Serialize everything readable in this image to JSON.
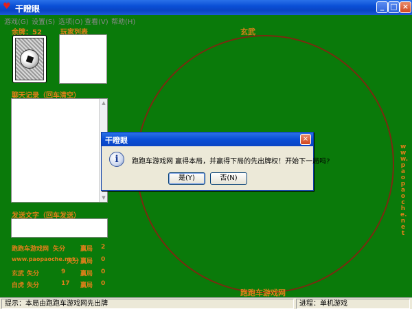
{
  "window": {
    "title": "干瞪眼"
  },
  "titlebar_buttons": {
    "minimize": "_",
    "maximize": "□",
    "close": "×"
  },
  "menu": [
    {
      "label": "游戏(G)"
    },
    {
      "label": "设置(S)"
    },
    {
      "label": "选项(O)"
    },
    {
      "label": "查看(V)"
    },
    {
      "label": "帮助(H)"
    }
  ],
  "left_panel": {
    "deck_label": "余牌：52",
    "player_list_label": "玩家列表",
    "chat_label": "聊天记录（回车清空）",
    "send_label": "发送文字（回车发送）",
    "scores": [
      {
        "name": "跑跑车游戏网",
        "score_label": "失分",
        "score": "",
        "win_label": "赢局",
        "wins": "2"
      },
      {
        "name": "www.paopaoche.net",
        "score_label": "失分",
        "score": "",
        "win_label": "赢局",
        "wins": "0"
      },
      {
        "name": "玄武",
        "score_label": "失分",
        "score": "9",
        "win_label": "赢局",
        "wins": "0"
      },
      {
        "name": "白虎",
        "score_label": "失分",
        "score": "17",
        "win_label": "赢局",
        "wins": "0"
      }
    ]
  },
  "table": {
    "top_seat": "玄武",
    "bottom_seat": "跑跑车游戏网",
    "right_url": "www.paopaoche.net"
  },
  "dialog": {
    "title": "干瞪眼",
    "message": "跑跑车游戏网 赢得本局，并赢得下局的先出牌权！开始下一局吗?",
    "yes_label": "是(Y)",
    "no_label": "否(N)",
    "icon": "info-icon"
  },
  "statusbar": {
    "hint": "提示：本局由跑跑车游戏网先出牌",
    "progress": "进程：单机游戏"
  },
  "colors": {
    "felt": "#0a7a0a",
    "label": "#e07f1a",
    "circle": "#7a2a10"
  }
}
